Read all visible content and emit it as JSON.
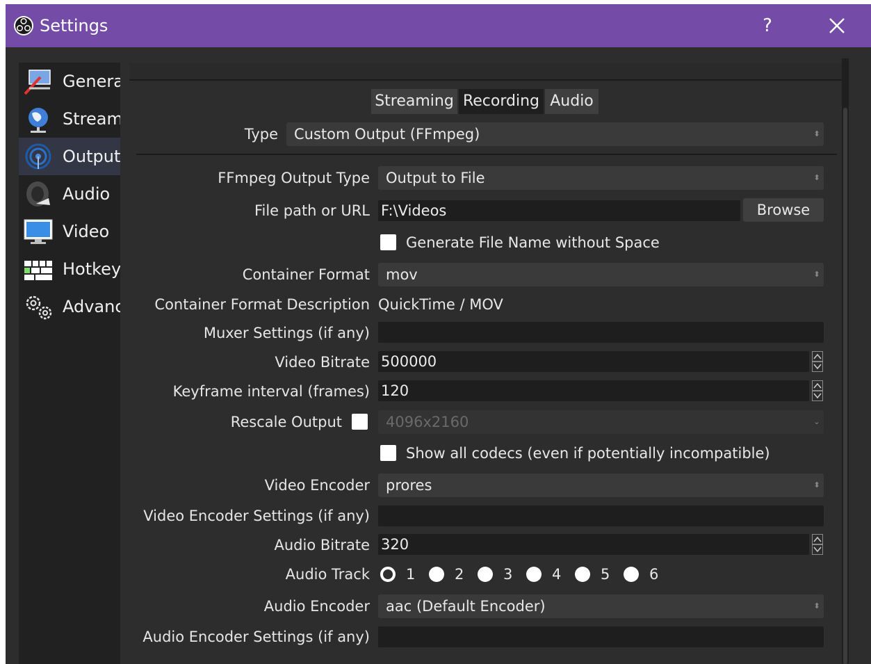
{
  "window": {
    "title": "Settings",
    "help": "?",
    "close": "close"
  },
  "sidebar": {
    "items": [
      {
        "label": "General",
        "icon": "general-icon"
      },
      {
        "label": "Stream",
        "icon": "stream-globe-icon"
      },
      {
        "label": "Output",
        "icon": "output-signal-icon",
        "active": true
      },
      {
        "label": "Audio",
        "icon": "speaker-icon"
      },
      {
        "label": "Video",
        "icon": "monitor-icon"
      },
      {
        "label": "Hotkeys",
        "icon": "keyboard-icon"
      },
      {
        "label": "Advanced",
        "icon": "gears-icon"
      }
    ]
  },
  "tabs": [
    {
      "label": "Streaming",
      "active": false
    },
    {
      "label": "Recording",
      "active": true
    },
    {
      "label": "Audio",
      "active": false
    }
  ],
  "type": {
    "label": "Type",
    "value": "Custom Output (FFmpeg)"
  },
  "form": {
    "ffmpeg_output_type": {
      "label": "FFmpeg Output Type",
      "value": "Output to File"
    },
    "file_path": {
      "label": "File path or URL",
      "value": "F:\\Videos",
      "browse": "Browse"
    },
    "generate_name": {
      "label": "Generate File Name without Space",
      "checked": false
    },
    "container_format": {
      "label": "Container Format",
      "value": "mov"
    },
    "container_desc": {
      "label": "Container Format Description",
      "value": "QuickTime / MOV"
    },
    "muxer_settings": {
      "label": "Muxer Settings (if any)",
      "value": ""
    },
    "video_bitrate": {
      "label": "Video Bitrate",
      "value": "500000"
    },
    "keyframe_interval": {
      "label": "Keyframe interval (frames)",
      "value": "120"
    },
    "rescale_output": {
      "label": "Rescale Output",
      "value": "4096x2160",
      "checked": false
    },
    "show_all_codecs": {
      "label": "Show all codecs (even if potentially incompatible)",
      "checked": false
    },
    "video_encoder": {
      "label": "Video Encoder",
      "value": "prores"
    },
    "video_encoder_settings": {
      "label": "Video Encoder Settings (if any)",
      "value": ""
    },
    "audio_bitrate": {
      "label": "Audio Bitrate",
      "value": "320"
    },
    "audio_track": {
      "label": "Audio Track",
      "options": [
        "1",
        "2",
        "3",
        "4",
        "5",
        "6"
      ],
      "selected": "1"
    },
    "audio_encoder": {
      "label": "Audio Encoder",
      "value": "aac (Default Encoder)"
    },
    "audio_encoder_settings": {
      "label": "Audio Encoder Settings (if any)",
      "value": ""
    }
  },
  "colors": {
    "titlebar": "#744ca8",
    "background": "#2d2d2d",
    "field": "#1e1e1e"
  }
}
